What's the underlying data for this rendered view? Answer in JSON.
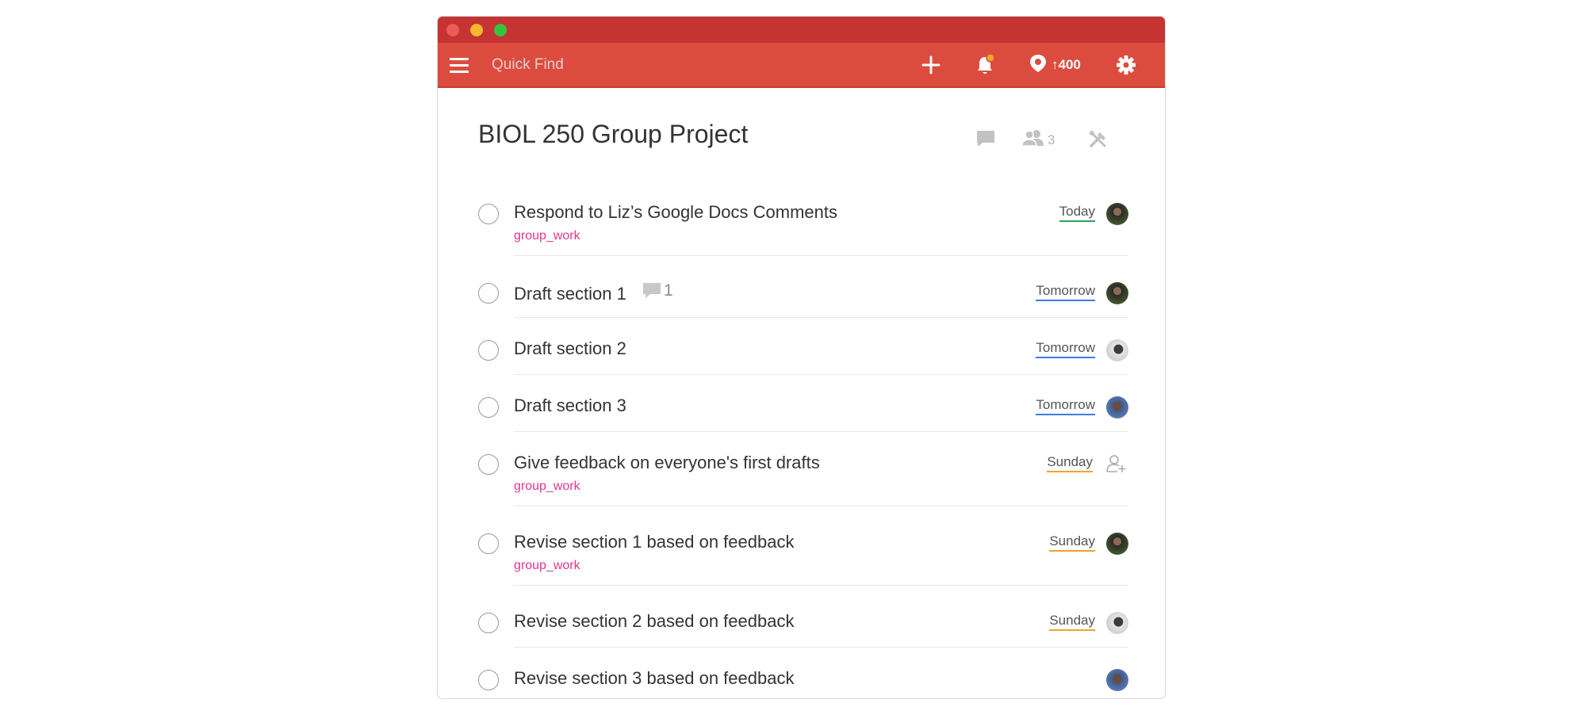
{
  "topbar": {
    "search_placeholder": "Quick Find",
    "karma_value": "400",
    "karma_arrow": "↑"
  },
  "project": {
    "title": "BIOL 250 Group Project",
    "collaborator_count": "3"
  },
  "tasks": [
    {
      "content": "Respond to Liz’s Google Docs Comments",
      "label": "group_work",
      "due": "Today",
      "due_type": "today",
      "assignee": "a1"
    },
    {
      "content": "Draft section 1",
      "comments": "1",
      "due": "Tomorrow",
      "due_type": "tomorrow",
      "assignee": "a1"
    },
    {
      "content": "Draft section 2",
      "due": "Tomorrow",
      "due_type": "tomorrow",
      "assignee": "a2"
    },
    {
      "content": "Draft section 3",
      "due": "Tomorrow",
      "due_type": "tomorrow",
      "assignee": "a3"
    },
    {
      "content": "Give feedback on everyone's first drafts",
      "label": "group_work",
      "due": "Sunday",
      "due_type": "sunday",
      "assignee": "none"
    },
    {
      "content": "Revise section 1 based on feedback",
      "label": "group_work",
      "due": "Sunday",
      "due_type": "sunday",
      "assignee": "a1"
    },
    {
      "content": "Revise section 2 based on feedback",
      "due": "Sunday",
      "due_type": "sunday",
      "assignee": "a2"
    },
    {
      "content": "Revise section 3 based on feedback",
      "assignee": "a3"
    }
  ],
  "colors": {
    "brand": "#db4c3f",
    "titlebar": "#c53333",
    "label": "#e0358f",
    "today": "#2ba45b",
    "tomorrow": "#3b7ddd",
    "sunday": "#f0a32b"
  },
  "icons": {
    "menu": "hamburger-icon",
    "add": "plus-icon",
    "notifications": "bell-icon",
    "karma": "karma-icon",
    "settings": "gear-icon",
    "comments": "comment-icon",
    "collaborators": "people-icon",
    "project_actions": "tools-icon",
    "assign": "add-person-icon"
  }
}
